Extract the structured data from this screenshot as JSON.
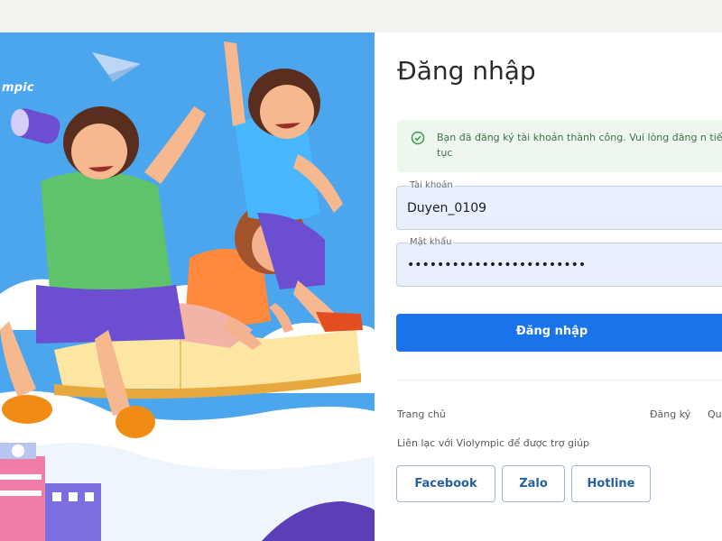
{
  "brand": {
    "text": "mpic"
  },
  "login": {
    "title": "Đăng nhập",
    "alert_message": "Bạn đã đăng ký tài khoản thành công. Vui lòng đăng n tiếp tục",
    "username_label": "Tài khoản",
    "username_value": "Duyen_0109",
    "password_label": "Mật khẩu",
    "password_value": "••••••••••••••••••••••••",
    "submit_label": "Đăng nhập"
  },
  "links": {
    "home": "Trang chủ",
    "register": "Đăng ký",
    "forgot_partial": "Qu"
  },
  "contact": {
    "help_text": "Liên lạc với Violympic để được trợ giúp",
    "facebook": "Facebook",
    "zalo": "Zalo",
    "hotline": "Hotline"
  },
  "colors": {
    "primary": "#1a73e8",
    "hero_bg": "#4ba6ee",
    "success_bg": "#eef7ee",
    "success_text": "#3e7046"
  }
}
